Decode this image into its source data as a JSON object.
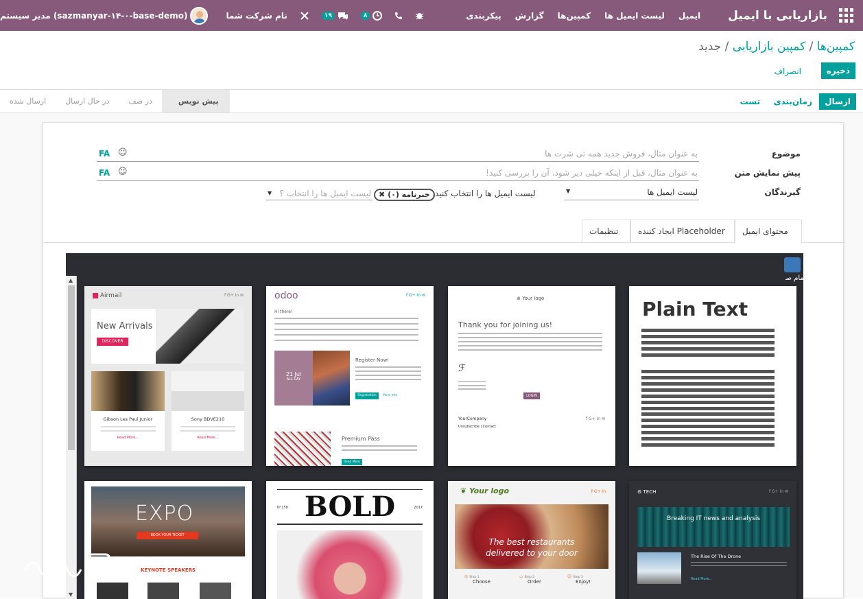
{
  "topbar": {
    "app_title": "بازاریابی با ایمیل",
    "menu": [
      "ایمیل",
      "لیست ایمیل ها",
      "کمپین‌ها",
      "گزارش",
      "پیکربندی"
    ],
    "company": "نام شرکت شما",
    "chat_count": "۱۹",
    "activity_count": "۸",
    "user": "مدیر سیستم (sazmanyar-۱۴-۰-base-demo)"
  },
  "breadcrumb": {
    "item1": "کمپین‌ها",
    "sep1": " / ",
    "item2": "کمپین بازاریابی",
    "sep2": " / ",
    "current": "جدید"
  },
  "actions": {
    "save": "ذخیره",
    "discard": "انصراف"
  },
  "statusbar": {
    "send": "ارسال",
    "schedule": "زمان‌بندی",
    "test": "تست",
    "stages": [
      "ارسال شده",
      "در حال ارسال",
      "در صف",
      "پیش نویس"
    ],
    "active_stage": "پیش نویس"
  },
  "form": {
    "subject_label": "موضوع",
    "subject_placeholder": "به عنوان مثال، فروش جدید همه تی شرت ها",
    "preview_label": "پیش نمایش متن",
    "preview_placeholder": "به عنوان مثال، قبل از اینکه خیلی دیر شود، آن را بررسی کنید!",
    "lang": "FA",
    "recipients_label": "گیرندگان",
    "recipients_value": "لیست ایمیل ها",
    "mailing_select_label": "لیست ایمیل ها را انتخاب کنید:",
    "newsletter_tag": "خبرنامه (۰)",
    "mailing_placeholder": "لیست ایمیل ها را انتخاب ؟"
  },
  "tabs": [
    "محتوای ایمیل",
    "ایجاد کننده Placeholder",
    "تنظیمات"
  ],
  "fullscreen_label": "تمام صف",
  "templates": {
    "plain_text": "Plain Text",
    "welcome": {
      "logo": "Your logo",
      "title": "Thank you for joining us!",
      "btn": "LOGIN",
      "company": "YourCompany",
      "links": "Unsubscribe | Contact"
    },
    "odoo": {
      "logo": "odoo",
      "greet": "Hi there!",
      "date": "21 Jul",
      "allday": "ALL DAY",
      "register": "Register Now!",
      "reg_btn": "Registration",
      "more": "More Info",
      "premium": "Premium Pass",
      "read": "Read More"
    },
    "airmail": {
      "logo": "Airmail",
      "title": "New Arrivals",
      "btn": "DISCOVER",
      "p1": "Gibson Les Paul Junior",
      "p2": "Sony BDVE210",
      "read1": "Read More...",
      "read2": "Read More..."
    },
    "tech": {
      "logo": "TECH",
      "headline": "Breaking IT news and analysis",
      "sub": "The Rise Of The Drone",
      "read": "Read More..."
    },
    "restaurant": {
      "logo": "Your logo",
      "tagline1": "The best restaurants",
      "tagline2": "delivered to your door",
      "s1": "Choose",
      "s2": "Order",
      "s3": "Enjoy!",
      "step1": "Step 1",
      "step2": "Step 2",
      "step3": "Step 3"
    },
    "bold": {
      "title": "BOLD",
      "num": "N°158",
      "year": "2017"
    },
    "expo": {
      "title": "EXPO",
      "btn": "BOOK YOUR TICKET",
      "speakers": "KEYNOTE SPEAKERS"
    }
  },
  "colors": {
    "primary": "#875a7b",
    "accent": "#00a09d"
  }
}
